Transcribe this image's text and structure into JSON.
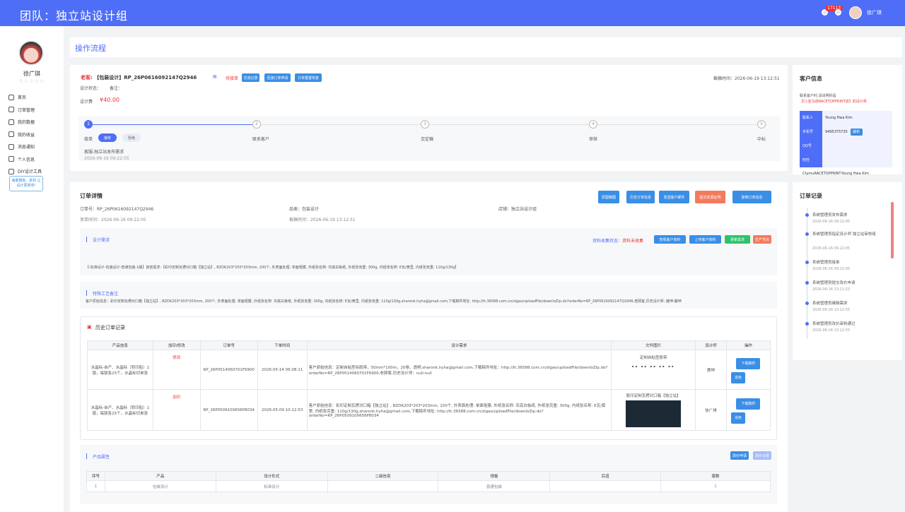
{
  "header": {
    "title": "团队：独立站设计组",
    "badge": "17113",
    "user": "徐广琪"
  },
  "sidebar": {
    "name": "徐广琪",
    "stars": "☆☆☆☆☆",
    "items": [
      {
        "label": "首页",
        "icon": "home-icon"
      },
      {
        "label": "订单管理",
        "icon": "monitor-icon"
      },
      {
        "label": "我的数据",
        "icon": "chart-icon"
      },
      {
        "label": "我的收益",
        "icon": "money-icon"
      },
      {
        "label": "消息通知",
        "icon": "message-icon"
      },
      {
        "label": "个人信息",
        "icon": "user-icon"
      },
      {
        "label": "DIY设计工具",
        "icon": "tool-icon"
      }
    ],
    "note": "海量模板、素材 让设计更简单!"
  },
  "crumb": "操作流程",
  "order": {
    "customer_prefix": "老客:",
    "title": "【包装设计】RP_26P0616092147Q2946",
    "status": "待接单",
    "btn_chat": "交流记录",
    "btn_cancel": "回滚订单申请",
    "btn_reset": "订单重置恢复",
    "deadline": "截稿时间：2026-06-19 13:12:51",
    "design_status": "设计状态：",
    "remark": "备注：",
    "fee_label": "设计费",
    "fee_value": "¥40.00",
    "steps": [
      "接单",
      "联系客户",
      "交定稿",
      "审核",
      "中标"
    ],
    "step_nums": [
      "1",
      "2",
      "3",
      "4",
      "5"
    ],
    "pill_accept": "接单",
    "pill_reject": "拒绝",
    "step_desc": "客服-独立站发布需求",
    "step_time": "2026-06-16 09:22:05"
  },
  "customer": {
    "title": "客户信息",
    "sub1": "联系客户时,请说明你是",
    "sub2": "【CI-亚马逊RACETOPPRINT店】的设计师",
    "rows": [
      {
        "k": "联系人",
        "v": "Young Hwa Kim"
      },
      {
        "k": "手机号",
        "v": "9495375735"
      },
      {
        "k": "QQ号",
        "v": ""
      },
      {
        "k": "旺旺",
        "v": ""
      }
    ],
    "parse_btn": "解析",
    "footer": "CtymuRACETOPPRINT-Young Hwa Kim"
  },
  "details": {
    "title": "订单详情",
    "buttons": [
      "原图稿图",
      "历史订单信息",
      "发送客户邮件",
      "提交资源证明",
      "复制订单信息"
    ],
    "order_no": "订单号：RP_26P0616092147Q2946",
    "category": "品类：包装设计",
    "shop": "店铺：独立站设计组",
    "pub_time": "发单时间：2026-06-16 09:22:05",
    "deadline": "截稿时间：2026-06-19 13:12:51",
    "req_title": "设计需求",
    "collect_label": "资料收集状态：",
    "collect_value": "资料未收集",
    "req_btns": [
      "查看客户资料",
      "上传客户资料",
      "更新需求",
      "生产节点"
    ],
    "req_text": "【-标准设计-包装设计-普通包装-1版】其他需求:【彩印定制瓦楞对口箱【独立站】, BZDK203*203*203mm, 200个, 外表面处理: 单面哑膜, 外纸张名称: 灰底白板纸, 外纸张克重: 300g, 内纸张名称: E瓦/黄里, 内纸张克重: 110g/130g】",
    "craft_title": "特殊工艺备注",
    "craft_text": "客户原始信息：彩印定制瓦楞对口箱【独立站】, BZDK203*203*203mm, 200个, 外表面处理: 单面哑膜, 外纸张名称: 灰底白板纸, 外纸张克重: 300g, 内纸张名称: E瓦/黄里, 内纸张克重: 110g/130g,sharonk.hyha@gmail.com,下载稿件地址: http://tt.36588.com.cn/zlgao/uploadFile/downloZip.do?orderNo=RP_26P0616092147Q2946,老顾客,历史设计师: 鹿坤-鹿坤",
    "history_title": "历史订单记录",
    "history_cols": [
      "产品信息",
      "加印/修改",
      "订单号",
      "下单时间",
      "设计需求",
      "文件图片",
      "设计师",
      "操作"
    ],
    "history_rows": [
      {
        "product": "水晶标-自产、水晶标（转印贴）1版，每版各25个，水晶标切单张",
        "type": "修改",
        "no": "RP_26P0514060701F6900",
        "time": "2026-05-14 06:08:11",
        "req": "客户原始信息：定制自粘型标胶带，50mm*100m，20卷，透明,sharonk.hyha@gmail.com,下载稿件地址：http://tt.36588.com.cn/zlgao/uploadFile/downloZip.do?orderNo=RP_26P0514060701F6900,老顾客,历史设计师：null-null",
        "file": "定制自粘型胶带",
        "designer": "鹿坤",
        "btn1": "下载稿件",
        "btn2": "追色"
      },
      {
        "product": "水晶标-自产、水晶标（转印贴）1版，每版各25个，水晶标切单张",
        "type": "加印",
        "no": "RP_26P0509100656P8034",
        "time": "2026-05-09 10:12:53",
        "req": "客户原始信息：彩印定制瓦楞对口箱【独立站】, BZDK203*203*203mm, 150个, 外表面处理: 单面哑膜, 外纸张名称: 灰底白板纸, 外纸张克重: 300g, 内纸张名称: E瓦/黄里, 内纸张克重: 110g/130g,sharonk.hyha@gmail.com,下载稿件地址: http://tt.36588.com.cn/zlgao/uploadFile/downloZip.do?orderNo=RP_26P0509100656P8034",
        "file": "胶印定制瓦楞对口箱【独立站】",
        "designer": "徐广琪",
        "btn1": "下载稿件",
        "btn2": "追色"
      }
    ],
    "attr_title": "产品属性",
    "attr_btns": [
      "改价申请",
      "改价记录"
    ],
    "attr_cols": [
      "序号",
      "产品",
      "设计形式",
      "二级信息",
      "规格",
      "后道",
      "版数"
    ],
    "attr_row": [
      "1",
      "包装设计",
      "标准设计",
      "",
      "普通包装",
      "",
      "1"
    ]
  },
  "records": {
    "title": "订单记录",
    "items": [
      {
        "text": "系统管理员发布需求",
        "time": "2026-06-16 09:22:05"
      },
      {
        "text": "系统管理员指定设计师 独立站审核组",
        "time": "2026-06-16 09:22:05"
      },
      {
        "text": "系统管理员接单",
        "time": "2026-06-16 09:22:05"
      },
      {
        "text": "系统管理员提交改价申请",
        "time": "2026-06-16 13:11:53"
      },
      {
        "text": "系统管理员编辑需求",
        "time": "2026-06-16 13:12:55"
      },
      {
        "text": "系统管理员改价审核通过",
        "time": "2026-06-16 13:12:55"
      }
    ]
  }
}
